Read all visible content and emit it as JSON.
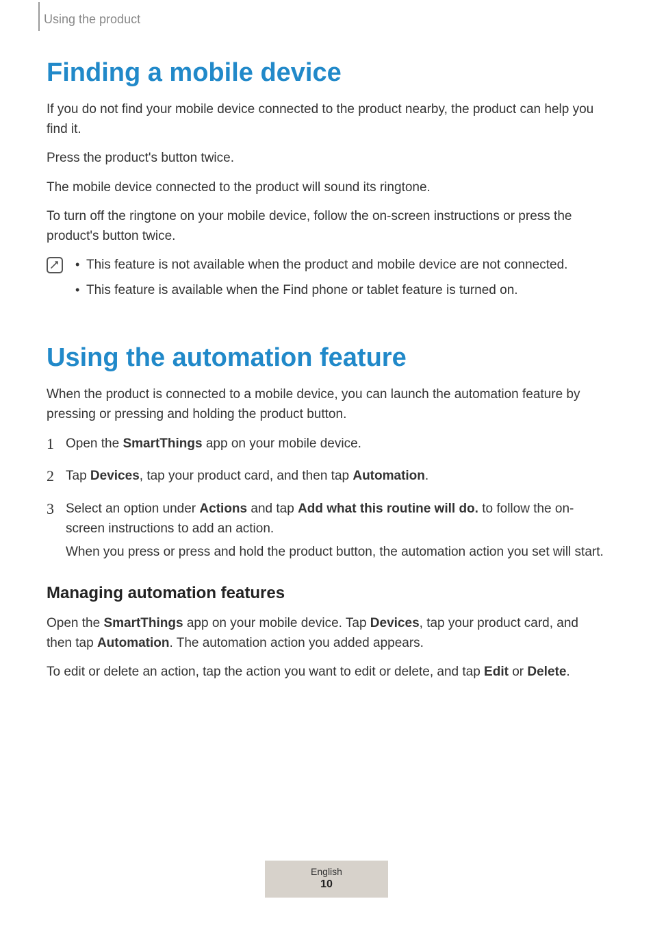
{
  "header": {
    "section_label": "Using the product"
  },
  "section1": {
    "title": "Finding a mobile device",
    "p1": "If you do not find your mobile device connected to the product nearby, the product can help you find it.",
    "p2": "Press the product's button twice.",
    "p3": "The mobile device connected to the product will sound its ringtone.",
    "p4": "To turn off the ringtone on your mobile device, follow the on-screen instructions or press the product's button twice.",
    "notes": [
      "This feature is not available when the product and mobile device are not connected.",
      "This feature is available when the Find phone or tablet feature is turned on."
    ]
  },
  "section2": {
    "title": "Using the automation feature",
    "intro": "When the product is connected to a mobile device, you can launch the automation feature by pressing or pressing and holding the product button.",
    "steps": {
      "s1": {
        "pre": "Open the ",
        "b1": "SmartThings",
        "post": " app on your mobile device."
      },
      "s2": {
        "pre": "Tap ",
        "b1": "Devices",
        "mid": ", tap your product card, and then tap ",
        "b2": "Automation",
        "post": "."
      },
      "s3": {
        "pre": "Select an option under ",
        "b1": "Actions",
        "mid": " and tap ",
        "b2": "Add what this routine will do.",
        "post": " to follow the on-screen instructions to add an action.",
        "line2": "When you press or press and hold the product button, the automation action you set will start."
      }
    },
    "sub": {
      "title": "Managing automation features",
      "p1": {
        "t1": "Open the ",
        "b1": "SmartThings",
        "t2": " app on your mobile device. Tap ",
        "b2": "Devices",
        "t3": ", tap your product card, and then tap ",
        "b3": "Automation",
        "t4": ". The automation action you added appears."
      },
      "p2": {
        "t1": "To edit or delete an action, tap the action you want to edit or delete, and tap ",
        "b1": "Edit",
        "t2": " or ",
        "b2": "Delete",
        "t3": "."
      }
    }
  },
  "footer": {
    "language": "English",
    "page": "10"
  }
}
